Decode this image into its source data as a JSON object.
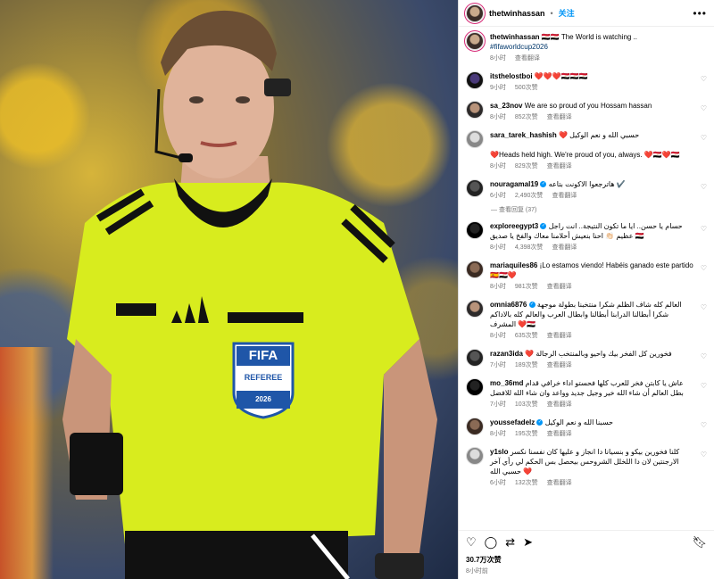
{
  "post": {
    "username": "thetwinhassan",
    "dot": "•",
    "follow_label": "关注",
    "more_icon": "more-horizontal-icon",
    "caption_user": "thetwinhassan",
    "caption_text": "🇪🇬🇪🇬 The World is watching ..",
    "hashtag": "#fifaworldcup2026",
    "caption_time": "8小时",
    "caption_translate": "查看翻译",
    "likes": "30.7万次赞",
    "time": "8小时前"
  },
  "photo": {
    "badge_top": "FIFA",
    "badge_bottom": "REFEREE",
    "badge_year": "2026"
  },
  "comments": [
    {
      "user": "itsthelostboi",
      "text": "❤️❤️❤️🇪🇬🇪🇬🇪🇬",
      "time": "9小时",
      "likes": "500次赞",
      "translate": "",
      "rtl": false
    },
    {
      "user": "sa_23nov",
      "text": "We are so proud of you Hossam hassan",
      "time": "8小时",
      "likes": "852次赞",
      "translate": "查看翻译",
      "rtl": false
    },
    {
      "user": "sara_tarek_hashish",
      "text": "❤️ حسبي الله و نعم الوكيل",
      "text2": "❤️Heads held high. We're proud of you, always. ❤️🇪🇬❤️🇪🇬",
      "time": "8小时",
      "likes": "829次赞",
      "translate": "查看翻译",
      "rtl": false
    },
    {
      "user": "nouragamal19",
      "text": "هاترجعوا الاكونت بتاعه ✔️",
      "time": "6小时",
      "likes": "2,490次赞",
      "translate": "查看翻译",
      "rtl": false,
      "verified": true
    },
    {
      "user": "exploreegypt3",
      "text": "حسام يا حسن.. ايا ما تكون النتيجة.. انت راجل عظيم 👏🏻 احنا بنعيش أحلامنا معاك والفخ يا صديق 🇪🇬",
      "time": "8小时",
      "likes": "4,398次赞",
      "translate": "查看翻译",
      "rtl": false,
      "verified": true
    },
    {
      "user": "mariaquiles86",
      "text": "¡Lo estamos viendo! Habéis ganado este partido 🇪🇸🇪🇬❤️",
      "time": "8小时",
      "likes": "981次赞",
      "translate": "查看翻译",
      "rtl": false
    },
    {
      "user": "omnia6876",
      "text": "العالم كله شاف الظلم شكرا منتخبنا بطولة موجهة شكرا أبطالنا الدرابنا أبطالنا وابطال العرب والعالم كله بالاداكم المشرف ❤️🇪🇬",
      "time": "8小时",
      "likes": "635次赞",
      "translate": "查看翻译",
      "rtl": false,
      "verified": true
    },
    {
      "user": "razan3ida",
      "text": "❤️ فخورين كل الفخر بيك واحيو وبالمنتخب الرجالة",
      "time": "7小时",
      "likes": "189次赞",
      "translate": "查看翻译",
      "rtl": false
    },
    {
      "user": "mo_36md",
      "text": "عاش يا كابتن فخر للعرب كلها فحستو اداء خرافي قدام بطل العالم أن شاء الله خير وجيل جديد وواعد وان شاء الله للافضل",
      "time": "7小时",
      "likes": "103次赞",
      "translate": "查看翻译",
      "rtl": false
    },
    {
      "user": "youssefadelz",
      "text": "حسبنا الله و نعم الوكيل",
      "time": "8小时",
      "likes": "195次赞",
      "translate": "查看翻译",
      "rtl": false,
      "verified": true
    },
    {
      "user": "y1slo",
      "text": "كلنا فخورين بيكو و بنسيانا دا انجاز و عليها كان نفسنا نكسر الارجنتين لان دا اللخلل الشروحس بيحصل بس الحكم لي رأي آخر حسبي الله ❤️",
      "time": "6小时",
      "likes": "132次赞",
      "translate": "查看翻译",
      "rtl": false
    }
  ],
  "replies_label": "查看回复 (37)",
  "actions": {
    "like_icon": "heart-icon",
    "comment_icon": "comment-icon",
    "share_icon": "repost-icon",
    "send_icon": "send-icon",
    "bookmark_icon": "bookmark-icon"
  },
  "colors": {
    "follow": "#0095f6",
    "jersey": "#d8ec1e",
    "hashtag": "#00376b"
  }
}
